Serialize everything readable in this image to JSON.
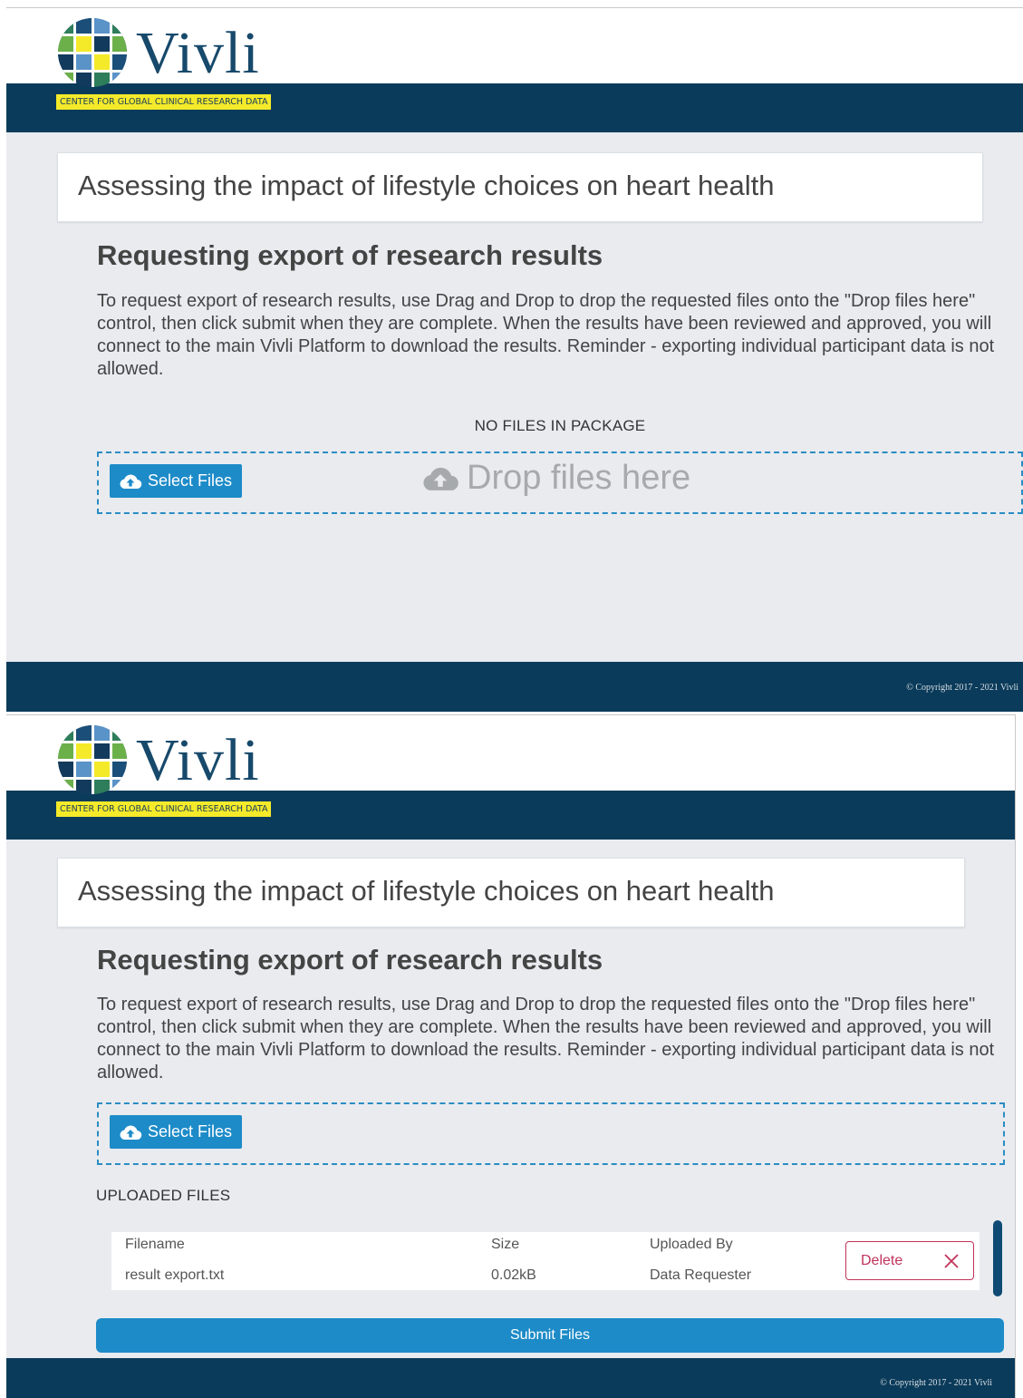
{
  "brand": {
    "name": "Vivli",
    "tagline": "CENTER FOR GLOBAL CLINICAL RESEARCH DATA",
    "colors": {
      "navy": "#0b3b5a",
      "tagline_yellow": "#f4ea2a",
      "accent_blue": "#1d8bc8",
      "delete_red": "#c0335a"
    }
  },
  "study": {
    "title": "Assessing the impact of lifestyle choices on heart health"
  },
  "export": {
    "heading": "Requesting export of research results",
    "instructions": "To request export of research results, use Drag and Drop to drop the requested files onto the \"Drop files here\" control, then click submit when they are complete. When the results have been reviewed and approved, you will connect to the main Vivli Platform to download the results. Reminder - exporting individual participant data is not allowed."
  },
  "empty_state": {
    "package_status": "NO FILES IN PACKAGE",
    "select_button": "Select Files",
    "drop_hint": "Drop files here"
  },
  "uploaded_state": {
    "select_button": "Select Files",
    "section_label": "UPLOADED FILES",
    "columns": {
      "filename": "Filename",
      "size": "Size",
      "uploaded_by": "Uploaded By"
    },
    "files": [
      {
        "filename": "result export.txt",
        "size": "0.02kB",
        "uploaded_by": "Data Requester",
        "action": "Delete"
      }
    ],
    "submit_button": "Submit Files"
  },
  "footer": {
    "copyright": "© Copyright 2017 - 2021 Vivli"
  },
  "icons": {
    "upload": "cloud-upload-icon",
    "delete": "close-icon"
  }
}
